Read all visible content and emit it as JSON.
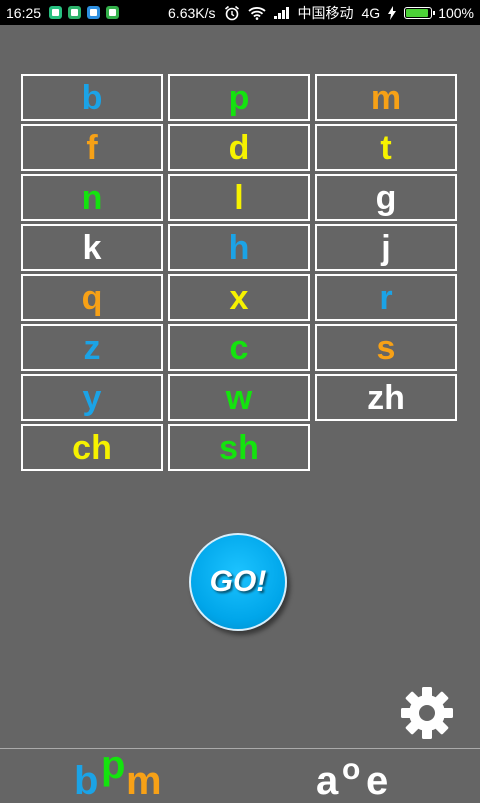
{
  "status_bar": {
    "time": "16:25",
    "net_speed": "6.63K/s",
    "carrier": "中国移动",
    "network": "4G",
    "battery": "100%",
    "icons": [
      "app-notification-icon",
      "app-notification-icon",
      "app-notification-icon",
      "app-notification-icon",
      "alarm-icon",
      "wifi-icon",
      "signal-icon",
      "charging-icon",
      "battery-icon"
    ]
  },
  "colors": {
    "background": "#656565",
    "blue": "#1ba3e6",
    "green": "#14e30e",
    "orange": "#f7a116",
    "yellow": "#f6f200",
    "white": "#ffffff"
  },
  "initials": [
    {
      "text": "b",
      "color": "blue"
    },
    {
      "text": "p",
      "color": "green"
    },
    {
      "text": "m",
      "color": "orange"
    },
    {
      "text": "f",
      "color": "orange"
    },
    {
      "text": "d",
      "color": "yellow"
    },
    {
      "text": "t",
      "color": "yellow"
    },
    {
      "text": "n",
      "color": "green"
    },
    {
      "text": "l",
      "color": "yellow"
    },
    {
      "text": "g",
      "color": "white"
    },
    {
      "text": "k",
      "color": "white"
    },
    {
      "text": "h",
      "color": "blue"
    },
    {
      "text": "j",
      "color": "white"
    },
    {
      "text": "q",
      "color": "orange"
    },
    {
      "text": "x",
      "color": "yellow"
    },
    {
      "text": "r",
      "color": "blue"
    },
    {
      "text": "z",
      "color": "blue"
    },
    {
      "text": "c",
      "color": "green"
    },
    {
      "text": "s",
      "color": "orange"
    },
    {
      "text": "y",
      "color": "blue"
    },
    {
      "text": "w",
      "color": "green"
    },
    {
      "text": "zh",
      "color": "white"
    },
    {
      "text": "ch",
      "color": "yellow"
    },
    {
      "text": "sh",
      "color": "green"
    }
  ],
  "go_button": {
    "label": "GO!"
  },
  "settings": {
    "icon": "gear-icon"
  },
  "tabs": [
    {
      "name": "initials",
      "glyphs": [
        {
          "text": "b",
          "color": "blue"
        },
        {
          "text": "p",
          "color": "green"
        },
        {
          "text": "m",
          "color": "orange"
        }
      ]
    },
    {
      "name": "finals",
      "glyphs": [
        {
          "text": "a",
          "color": "white"
        },
        {
          "text": "o",
          "color": "white"
        },
        {
          "text": "e",
          "color": "white"
        }
      ]
    }
  ]
}
